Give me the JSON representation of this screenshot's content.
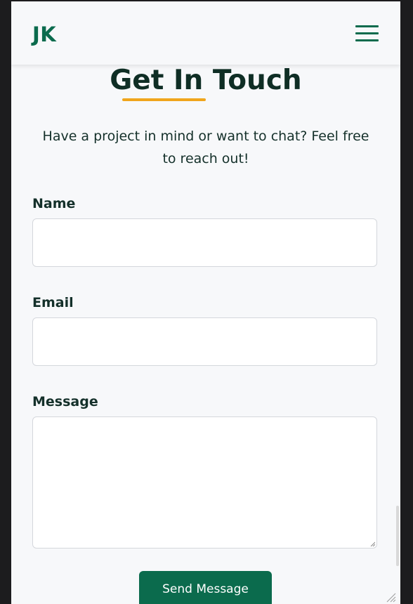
{
  "navbar": {
    "logo": "JK",
    "menu_icon": "hamburger-menu-icon"
  },
  "contact": {
    "title": "Get In Touch",
    "subtitle": "Have a project in mind or want to chat? Feel free to reach out!",
    "name_label": "Name",
    "name_value": "",
    "email_label": "Email",
    "email_value": "",
    "message_label": "Message",
    "message_value": "",
    "submit_label": "Send Message"
  },
  "colors": {
    "brand_green": "#0b6b4d",
    "accent_orange": "#f0a51c",
    "text_dark": "#14302a",
    "page_bg": "#f7f8fa"
  }
}
